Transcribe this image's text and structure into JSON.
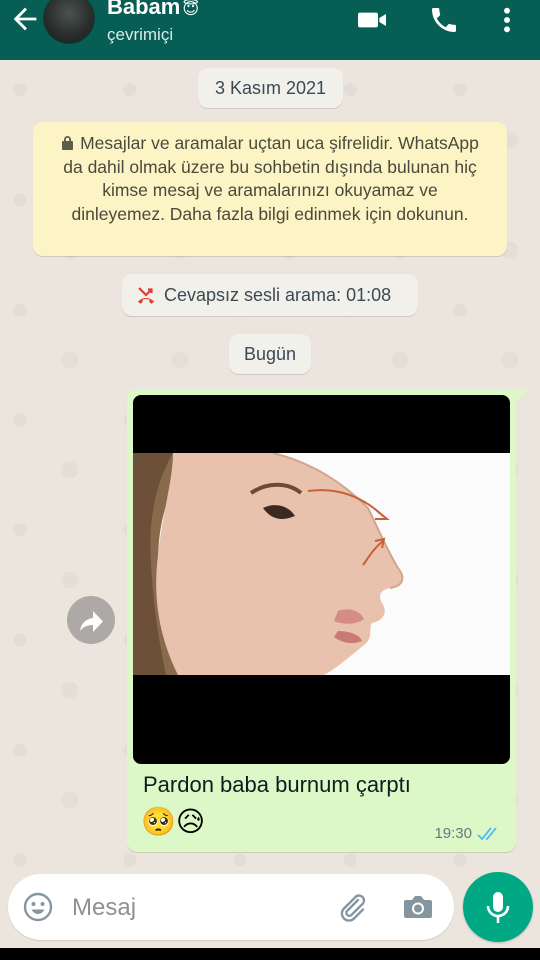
{
  "header": {
    "title": "Babam",
    "title_emoji": "😇",
    "status": "çevrimiçi",
    "icons": [
      "back-arrow-icon",
      "avatar",
      "video-call-icon",
      "phone-call-icon",
      "more-vert-icon"
    ]
  },
  "chat": {
    "date_chip": "3 Kasım 2021",
    "encryption_notice": "Mesajlar ve aramalar uçtan uca şifrelidir. WhatsApp da dahil olmak üzere bu sohbetin dışında bulunan hiç kimse mesaj ve aramalarınızı okuyamaz ve dinleyemez. Daha fazla bilgi edinmek için dokunun.",
    "missed_call": "Cevapsız sesli arama: 01:08",
    "today_chip": "Bugün",
    "message": {
      "caption": "Pardon baba burnum çarptı",
      "emoji": "🥺😥",
      "time": "19:30",
      "status": "read"
    }
  },
  "composer": {
    "placeholder": "Mesaj"
  },
  "colors": {
    "header": "#075e54",
    "outgoing_bubble": "#dcf8c6",
    "encryption_bg": "#fdf4c5",
    "mic_button": "#00a884",
    "read_ticks": "#53bdeb",
    "missed_call_red": "#e53935"
  }
}
